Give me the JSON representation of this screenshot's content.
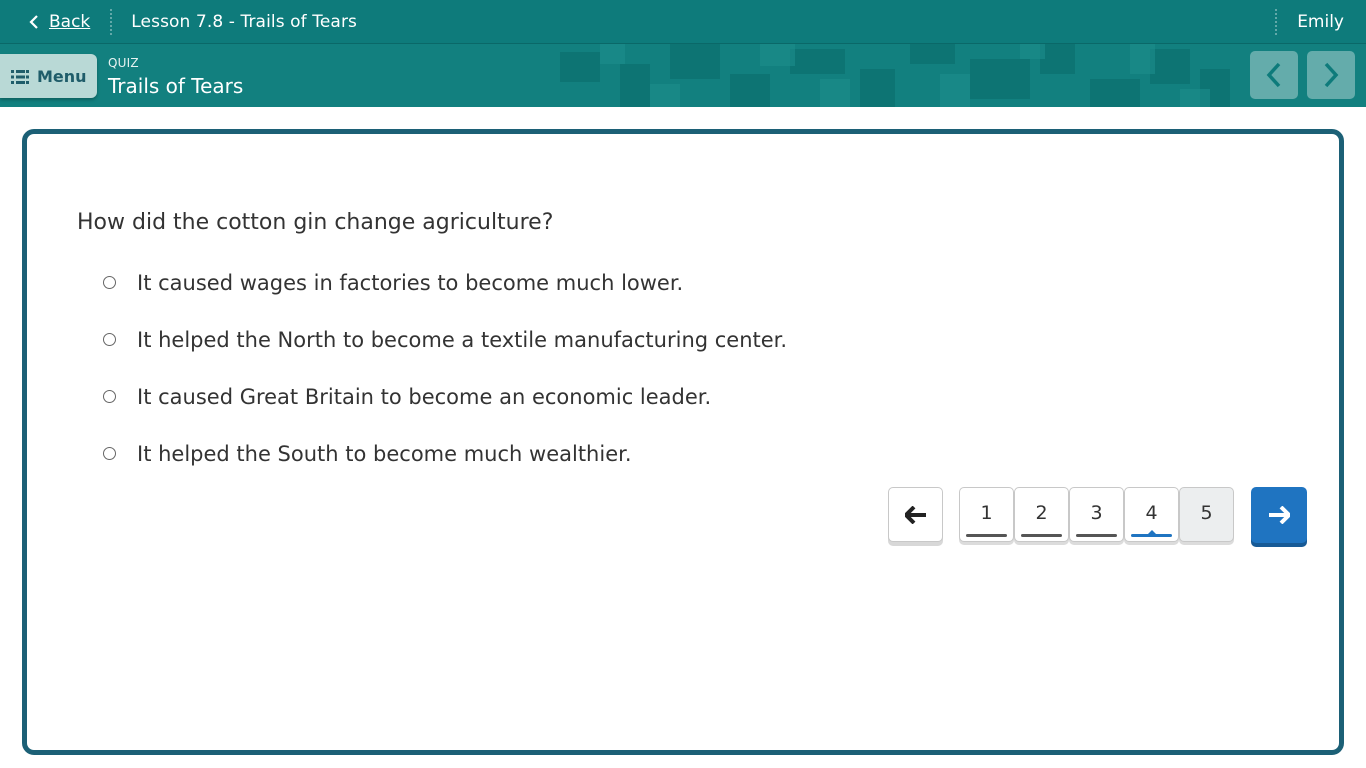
{
  "topbar": {
    "back_label": "Back",
    "lesson_title": "Lesson 7.8 - Trails of Tears",
    "user_name": "Emily"
  },
  "subbar": {
    "menu_label": "Menu",
    "quiz_kind": "QUIZ",
    "quiz_title": "Trails of Tears"
  },
  "question": {
    "text": "How did the cotton gin change agriculture?",
    "options": [
      "It caused wages in factories to become much lower.",
      "It helped the North to become a textile manufacturing center.",
      "It caused Great Britain to become an economic leader.",
      "It helped the South to become much wealthier."
    ]
  },
  "pager": {
    "pages": [
      "1",
      "2",
      "3",
      "4",
      "5"
    ],
    "current_page": "4"
  },
  "colors": {
    "topbar": "#0e7b7b",
    "card_border": "#1c6076",
    "accent_blue": "#1f74c1"
  },
  "icons": {
    "back": "chevron-left-icon",
    "menu": "menu-list-icon",
    "prev": "arrow-left-icon",
    "next": "arrow-right-icon"
  }
}
